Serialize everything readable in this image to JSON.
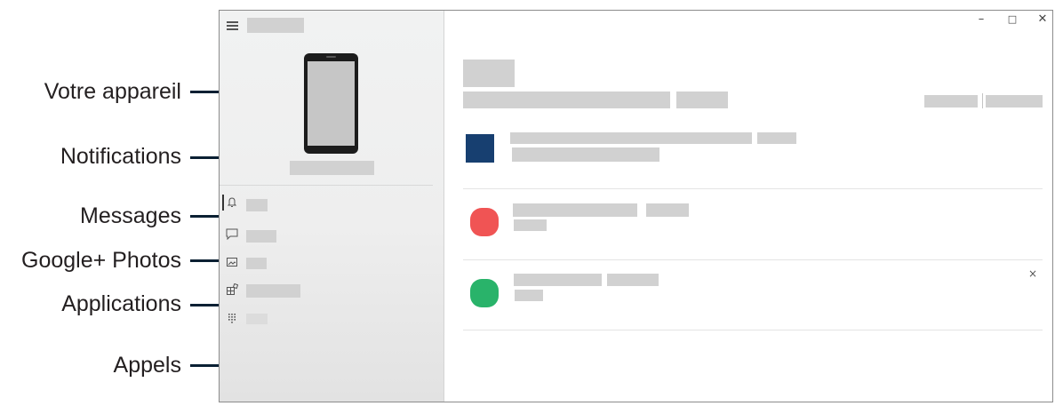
{
  "callouts": [
    {
      "id": "votre-appareil",
      "label": "Votre appareil"
    },
    {
      "id": "notifications",
      "label": "Notifications"
    },
    {
      "id": "messages",
      "label": "Messages"
    },
    {
      "id": "google-photos",
      "label": "Google+ Photos"
    },
    {
      "id": "applications",
      "label": "Applications"
    },
    {
      "id": "appels",
      "label": "Appels"
    }
  ],
  "window_controls": {
    "minimize": "–",
    "maximize": "□",
    "close": "✕"
  },
  "sidebar": {
    "menu_icon": "hamburger-menu-icon",
    "nav_items": [
      {
        "name": "notifications",
        "icon": "bell-icon",
        "glyph": "🔔",
        "active": true
      },
      {
        "name": "messages",
        "icon": "chat-bubble-icon",
        "glyph": "▭",
        "active": false
      },
      {
        "name": "photos",
        "icon": "image-icon",
        "glyph": "▣",
        "active": false
      },
      {
        "name": "applications",
        "icon": "apps-grid-icon",
        "glyph": "⊞",
        "active": false
      },
      {
        "name": "calls",
        "icon": "dialpad-icon",
        "glyph": "⠿",
        "active": false
      }
    ]
  },
  "notifications_list": {
    "dismiss_glyph": "×",
    "items": [
      {
        "app_color": "#173f70",
        "icon": "square-app-icon"
      },
      {
        "app_color": "#f05454",
        "icon": "rounded-app-icon"
      },
      {
        "app_color": "#29b36a",
        "icon": "rounded-app-icon"
      }
    ]
  },
  "colors": {
    "leader_line": "#0a2033",
    "placeholder": "#d1d1d1",
    "window_border": "#8c8c8c"
  }
}
